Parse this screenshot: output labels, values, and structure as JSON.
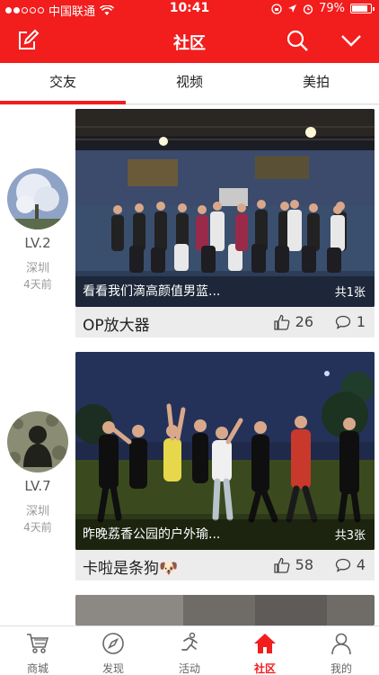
{
  "status_bar": {
    "carrier": "中国联通",
    "time": "10:41",
    "battery": "79%"
  },
  "header": {
    "title": "社区",
    "icons": [
      "edit-icon",
      "search-icon",
      "chevron-down-icon"
    ]
  },
  "tabs": [
    {
      "label": "交友",
      "active": true
    },
    {
      "label": "视频",
      "active": false
    },
    {
      "label": "美拍",
      "active": false
    }
  ],
  "posts": [
    {
      "author": {
        "level": "LV.2",
        "city": "深圳",
        "ago": "4天前"
      },
      "caption": "看看我们滴高颜值男蓝...",
      "photo_count": "共1张",
      "title": "OP放大器",
      "likes": "26",
      "comments": "1"
    },
    {
      "author": {
        "level": "LV.7",
        "city": "深圳",
        "ago": "4天前"
      },
      "caption": "昨晚荔香公园的户外瑜...",
      "photo_count": "共3张",
      "title": "卡啦是条狗🐶",
      "likes": "58",
      "comments": "4"
    }
  ],
  "bottom_nav": [
    {
      "label": "商城",
      "icon": "cart-icon"
    },
    {
      "label": "发现",
      "icon": "compass-icon"
    },
    {
      "label": "活动",
      "icon": "runner-icon"
    },
    {
      "label": "社区",
      "icon": "home-icon",
      "active": true
    },
    {
      "label": "我的",
      "icon": "user-icon"
    }
  ],
  "colors": {
    "brand": "#f21d1d"
  }
}
